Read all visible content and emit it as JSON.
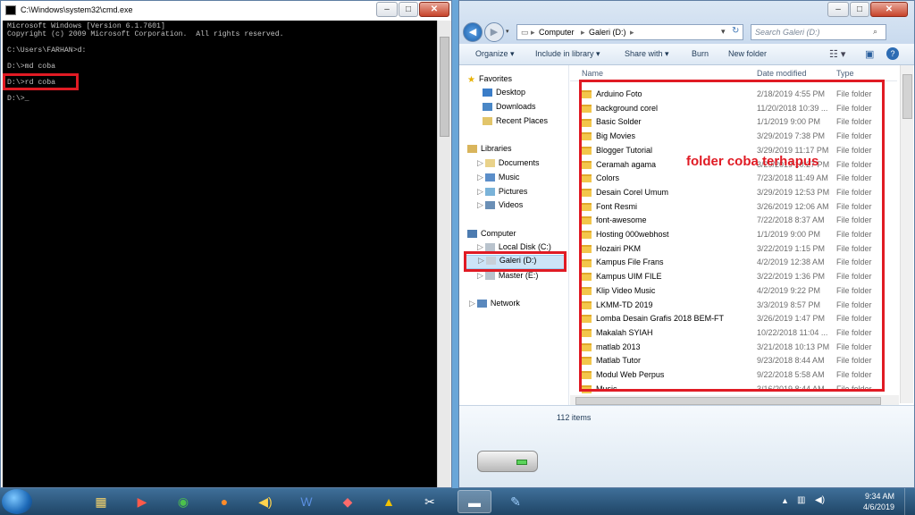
{
  "cmd": {
    "title": "C:\\Windows\\system32\\cmd.exe",
    "lines": [
      "Microsoft Windows [Version 6.1.7601]",
      "Copyright (c) 2009 Microsoft Corporation.  All rights reserved.",
      "",
      "C:\\Users\\FARHAN>d:",
      "",
      "D:\\>md coba",
      "",
      "D:\\>rd coba",
      "",
      "D:\\>_"
    ]
  },
  "window_buttons": {
    "minimize": "–",
    "maximize": "□",
    "close": "✕"
  },
  "explorer": {
    "address": [
      "Computer",
      "Galeri (D:)"
    ],
    "search_placeholder": "Search Galeri (D:)",
    "toolbar": [
      "Organize ▾",
      "Include in library ▾",
      "Share with ▾",
      "Burn",
      "New folder"
    ],
    "columns": {
      "name": "Name",
      "date": "Date modified",
      "type": "Type"
    },
    "nav": {
      "favorites": "Favorites",
      "desktop": "Desktop",
      "downloads": "Downloads",
      "recent": "Recent Places",
      "libraries": "Libraries",
      "documents": "Documents",
      "music": "Music",
      "pictures": "Pictures",
      "videos": "Videos",
      "computer": "Computer",
      "local_disk": "Local Disk (C:)",
      "galeri": "Galeri (D:)",
      "master": "Master (E:)",
      "network": "Network"
    },
    "files": [
      {
        "name": "Arduino Foto",
        "date": "2/18/2019 4:55 PM",
        "type": "File folder"
      },
      {
        "name": "background corel",
        "date": "11/20/2018 10:39 ...",
        "type": "File folder"
      },
      {
        "name": "Basic Solder",
        "date": "1/1/2019 9:00 PM",
        "type": "File folder"
      },
      {
        "name": "Big Movies",
        "date": "3/29/2019 7:38 PM",
        "type": "File folder"
      },
      {
        "name": "Blogger Tutorial",
        "date": "3/29/2019 11:17 PM",
        "type": "File folder"
      },
      {
        "name": "Ceramah agama",
        "date": "3/29/2019 10:27 PM",
        "type": "File folder"
      },
      {
        "name": "Colors",
        "date": "7/23/2018 11:49 AM",
        "type": "File folder"
      },
      {
        "name": "Desain Corel Umum",
        "date": "3/29/2019 12:53 PM",
        "type": "File folder"
      },
      {
        "name": "Font Resmi",
        "date": "3/26/2019 12:06 AM",
        "type": "File folder"
      },
      {
        "name": "font-awesome",
        "date": "7/22/2018 8:37 AM",
        "type": "File folder"
      },
      {
        "name": "Hosting 000webhost",
        "date": "1/1/2019 9:00 PM",
        "type": "File folder"
      },
      {
        "name": "Hozairi PKM",
        "date": "3/22/2019 1:15 PM",
        "type": "File folder"
      },
      {
        "name": "Kampus File Frans",
        "date": "4/2/2019 12:38 AM",
        "type": "File folder"
      },
      {
        "name": "Kampus UIM FILE",
        "date": "3/22/2019 1:36 PM",
        "type": "File folder"
      },
      {
        "name": "Klip Video Music",
        "date": "4/2/2019 9:22 PM",
        "type": "File folder"
      },
      {
        "name": "LKMM-TD 2019",
        "date": "3/3/2019 8:57 PM",
        "type": "File folder"
      },
      {
        "name": "Lomba Desain Grafis 2018 BEM-FT",
        "date": "3/26/2019 1:47 PM",
        "type": "File folder"
      },
      {
        "name": "Makalah SYIAH",
        "date": "10/22/2018 11:04 ...",
        "type": "File folder"
      },
      {
        "name": "matlab 2013",
        "date": "3/21/2018 10:13 PM",
        "type": "File folder"
      },
      {
        "name": "Matlab Tutor",
        "date": "9/23/2018 8:44 AM",
        "type": "File folder"
      },
      {
        "name": "Modul Web Perpus",
        "date": "9/22/2018 5:58 AM",
        "type": "File folder"
      },
      {
        "name": "Music",
        "date": "3/16/2019 8:44 AM",
        "type": "File folder"
      }
    ],
    "item_count": "112 items"
  },
  "annotation": "folder coba terhapus",
  "taskbar": {
    "time": "9:34 AM",
    "date": "4/6/2019"
  }
}
